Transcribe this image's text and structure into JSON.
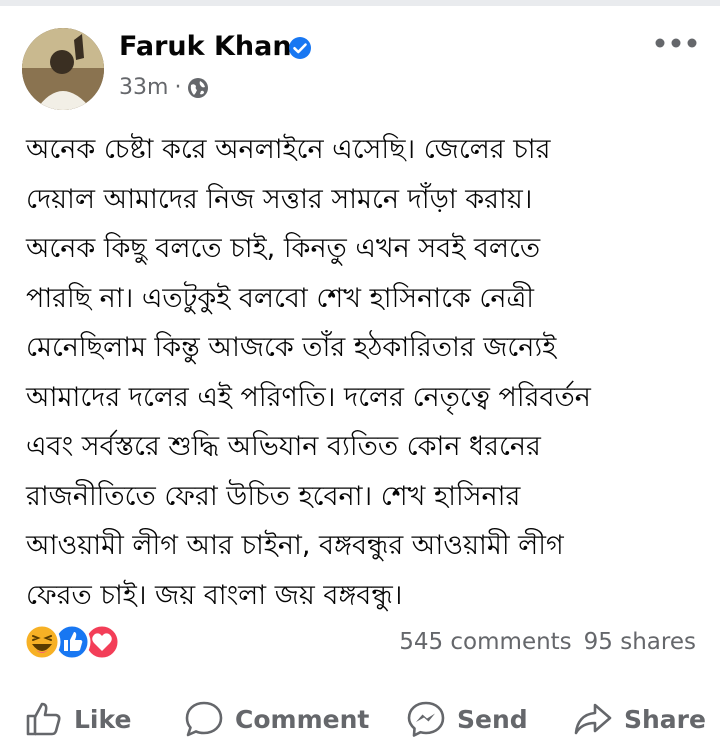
{
  "author": {
    "name": "Faruk Khan",
    "verified": true,
    "avatar": "avatar-image"
  },
  "meta": {
    "time": "33m",
    "separator": "·",
    "audience_icon": "globe-icon"
  },
  "more_icon": "more-icon",
  "post": {
    "lines": [
      "অনেক চেষ্টা করে অনলাইনে এসেছি। জেলের চার",
      "দেয়াল আমাদের নিজ সত্তার সামনে দাঁড়া করায়।",
      "অনেক কিছু বলতে চাই, কিনতু এখন সবই বলতে",
      "পারছি না। এতটুকুই বলবো শেখ হাসিনাকে নেত্রী",
      "মেনেছিলাম কিন্তু আজকে তাঁর হঠকারিতার জন্যেই",
      "আমাদের দলের এই পরিণতি। দলের নেতৃত্বে পরিবর্তন",
      "এবং সর্বস্তরে শুদ্ধি অভিযান ব্যতিত কোন ধরনের",
      "রাজনীতিতে ফেরা উচিত হবেনা। শেখ হাসিনার",
      "আওয়ামী লীগ আর চাইনা, বঙ্গবন্ধুর আওয়ামী লীগ",
      "ফেরত চাই। জয় বাংলা জয় বঙ্গবন্ধু।"
    ]
  },
  "reactions": [
    "haha",
    "like",
    "love"
  ],
  "stats": {
    "comments": "545 comments",
    "shares": "95 shares"
  },
  "actions": {
    "like": "Like",
    "comment": "Comment",
    "send": "Send",
    "share": "Share"
  },
  "colors": {
    "verified": "#1877f2",
    "like": "#1877f2",
    "love": "#f33e58",
    "haha": "#f7b125",
    "muted": "#65676b"
  }
}
